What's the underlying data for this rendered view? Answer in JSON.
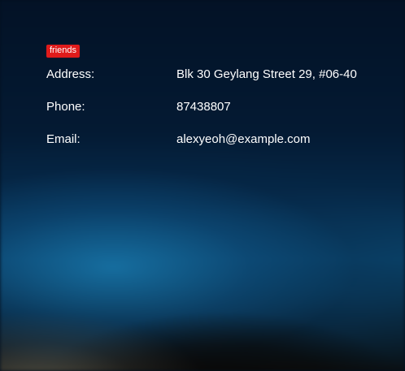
{
  "person": {
    "tags": [
      "friends"
    ],
    "fields": {
      "address": {
        "label": "Address:",
        "value": "Blk 30 Geylang Street 29, #06-40"
      },
      "phone": {
        "label": "Phone:",
        "value": "87438807"
      },
      "email": {
        "label": "Email:",
        "value": "alexyeoh@example.com"
      }
    }
  },
  "colors": {
    "tag_background": "#e01b1b",
    "text": "#ffffff"
  }
}
